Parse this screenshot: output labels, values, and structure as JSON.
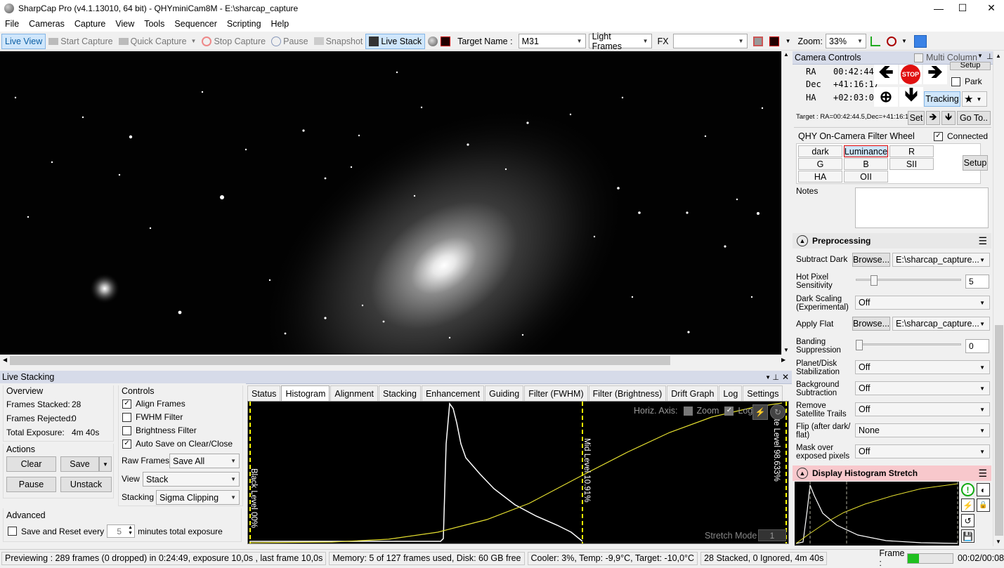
{
  "window": {
    "title": "SharpCap Pro (v4.1.13010, 64 bit) - QHYminiCam8M - E:\\sharcap_capture",
    "min": "—",
    "max": "☐",
    "close": "✕"
  },
  "menu": [
    "File",
    "Cameras",
    "Capture",
    "View",
    "Tools",
    "Sequencer",
    "Scripting",
    "Help"
  ],
  "toolbar": {
    "live_view": "Live View",
    "start_capture": "Start Capture",
    "quick_capture": "Quick Capture",
    "stop_capture": "Stop Capture",
    "pause": "Pause",
    "snapshot": "Snapshot",
    "live_stack": "Live Stack",
    "target_label": "Target Name :",
    "target_value": "M31",
    "frame_type": "Light Frames",
    "fx_label": "FX",
    "fx_value": "",
    "zoom_label": "Zoom:",
    "zoom_value": "33%"
  },
  "live_stacking": {
    "panel_title": "Live Stacking",
    "overview": {
      "title": "Overview",
      "frames_stacked_label": "Frames Stacked:",
      "frames_stacked": "28",
      "frames_rejected_label": "Frames Rejected:",
      "frames_rejected": "0",
      "total_exposure_label": "Total Exposure:",
      "total_exposure": "4m 40s"
    },
    "actions": {
      "title": "Actions",
      "clear": "Clear",
      "save": "Save",
      "pause": "Pause",
      "unstack": "Unstack"
    },
    "controls": {
      "title": "Controls",
      "align_frames": "Align Frames",
      "fwhm_filter": "FWHM Filter",
      "brightness_filter": "Brightness Filter",
      "auto_save": "Auto Save on Clear/Close",
      "raw_frames_label": "Raw Frames",
      "raw_frames_value": "Save All",
      "view_label": "View",
      "view_value": "Stack",
      "stacking_label": "Stacking",
      "stacking_value": "Sigma Clipping"
    },
    "advanced": {
      "title": "Advanced",
      "save_reset_label": "Save and Reset every",
      "save_reset_value": "5",
      "minutes_label": "minutes total exposure"
    },
    "tabs": [
      "Status",
      "Histogram",
      "Alignment",
      "Stacking",
      "Enhancement",
      "Guiding",
      "Filter (FWHM)",
      "Filter (Brightness)",
      "Drift Graph",
      "Log",
      "Settings"
    ],
    "histogram": {
      "horiz_axis_label": "Horiz. Axis:",
      "zoom_label": "Zoom",
      "log_label": "Log",
      "black_level": "Black Level  00%",
      "mid_level": "Mid Level  10.91%",
      "white_level": "White Level  98.633%",
      "stretch_mode_label": "Stretch Mode",
      "stretch_mode_value": "1"
    }
  },
  "camera_controls": {
    "title": "Camera Controls",
    "multi_column": "Multi Column",
    "setup": "Setup",
    "ra_label": "RA",
    "ra_value": "00:42:44",
    "dec_label": "Dec",
    "dec_value": "+41:16:17",
    "ha_label": "HA",
    "ha_value": "+02:03:04",
    "stop": "STOP",
    "park": "Park",
    "tracking": "Tracking",
    "target_text": "Target : RA=00:42:44.5,Dec=+41:16:18",
    "set": "Set",
    "goto": "Go To..",
    "filter_wheel_title": "QHY On-Camera Filter Wheel",
    "connected": "Connected",
    "filters": [
      "dark",
      "Luminance",
      "R",
      "G",
      "B",
      "SII",
      "HA",
      "OII"
    ],
    "fw_setup": "Setup",
    "notes_label": "Notes"
  },
  "preprocessing": {
    "title": "Preprocessing",
    "subtract_dark_label": "Subtract Dark",
    "browse": "Browse...",
    "dark_path": "E:\\sharcap_capture...",
    "hot_pixel_label1": "Hot Pixel",
    "hot_pixel_label2": "Sensitivity",
    "hot_pixel_value": "5",
    "dark_scaling_label1": "Dark Scaling",
    "dark_scaling_label2": "(Experimental)",
    "dark_scaling_value": "Off",
    "apply_flat_label": "Apply Flat",
    "flat_path": "E:\\sharcap_capture...",
    "banding_label1": "Banding",
    "banding_label2": "Suppression",
    "banding_value": "0",
    "planet_label1": "Planet/Disk",
    "planet_label2": "Stabilization",
    "planet_value": "Off",
    "background_label1": "Background",
    "background_label2": "Subtraction",
    "background_value": "Off",
    "remove_label1": "Remove",
    "remove_label2": "Satellite Trails",
    "remove_value": "Off",
    "flip_label1": "Flip (after dark/",
    "flip_label2": "flat)",
    "flip_value": "None",
    "mask_label1": "Mask over",
    "mask_label2": "exposed pixels",
    "mask_value": "Off"
  },
  "display_stretch": {
    "title": "Display Histogram Stretch"
  },
  "status_bar": {
    "preview": "Previewing : 289 frames (0 dropped) in 0:24:49, exposure 10,0s , last frame 10,0s",
    "memory": "Memory: 5 of 127 frames used, Disk: 60 GB free",
    "cooler": "Cooler: 3%, Temp: -9,9°C, Target: -10,0°C",
    "stacked": "28 Stacked, 0 Ignored, 4m 40s",
    "frame_label": "Frame :",
    "frame_time": "00:02/00:08",
    "frame_progress": 0.25
  },
  "colors": {
    "accent": "#cfe6fb",
    "panel_header": "#d6dbe9",
    "stretch_header": "#f8c8cc",
    "curve": "#e6e030",
    "level_line": "#ffff00",
    "progress": "#20c020"
  }
}
